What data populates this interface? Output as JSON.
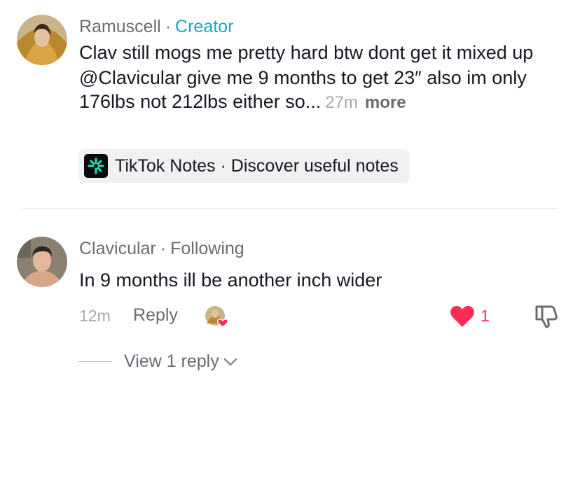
{
  "comments": [
    {
      "username": "Ramuscell",
      "separator": "·",
      "role": "Creator",
      "line1": "Clav still mogs me pretty hard btw dont get it mixed up",
      "mention": "@Clavicular",
      "line2": " give me 9 months to get 23″ also im only 176lbs not 212lbs either so...",
      "time": "27m",
      "more": "more",
      "chip": {
        "label": "TikTok Notes · Discover useful notes",
        "icon": "tiktok-notes-icon"
      }
    },
    {
      "username": "Clavicular",
      "separator": "·",
      "relation": "Following",
      "text": "In 9 months ill be another inch wider",
      "time": "12m",
      "reply_label": "Reply",
      "like_count": "1",
      "view_replies": "View 1 reply",
      "colors": {
        "like": "#fe2c55",
        "creator": "#1aa6c2"
      }
    }
  ]
}
